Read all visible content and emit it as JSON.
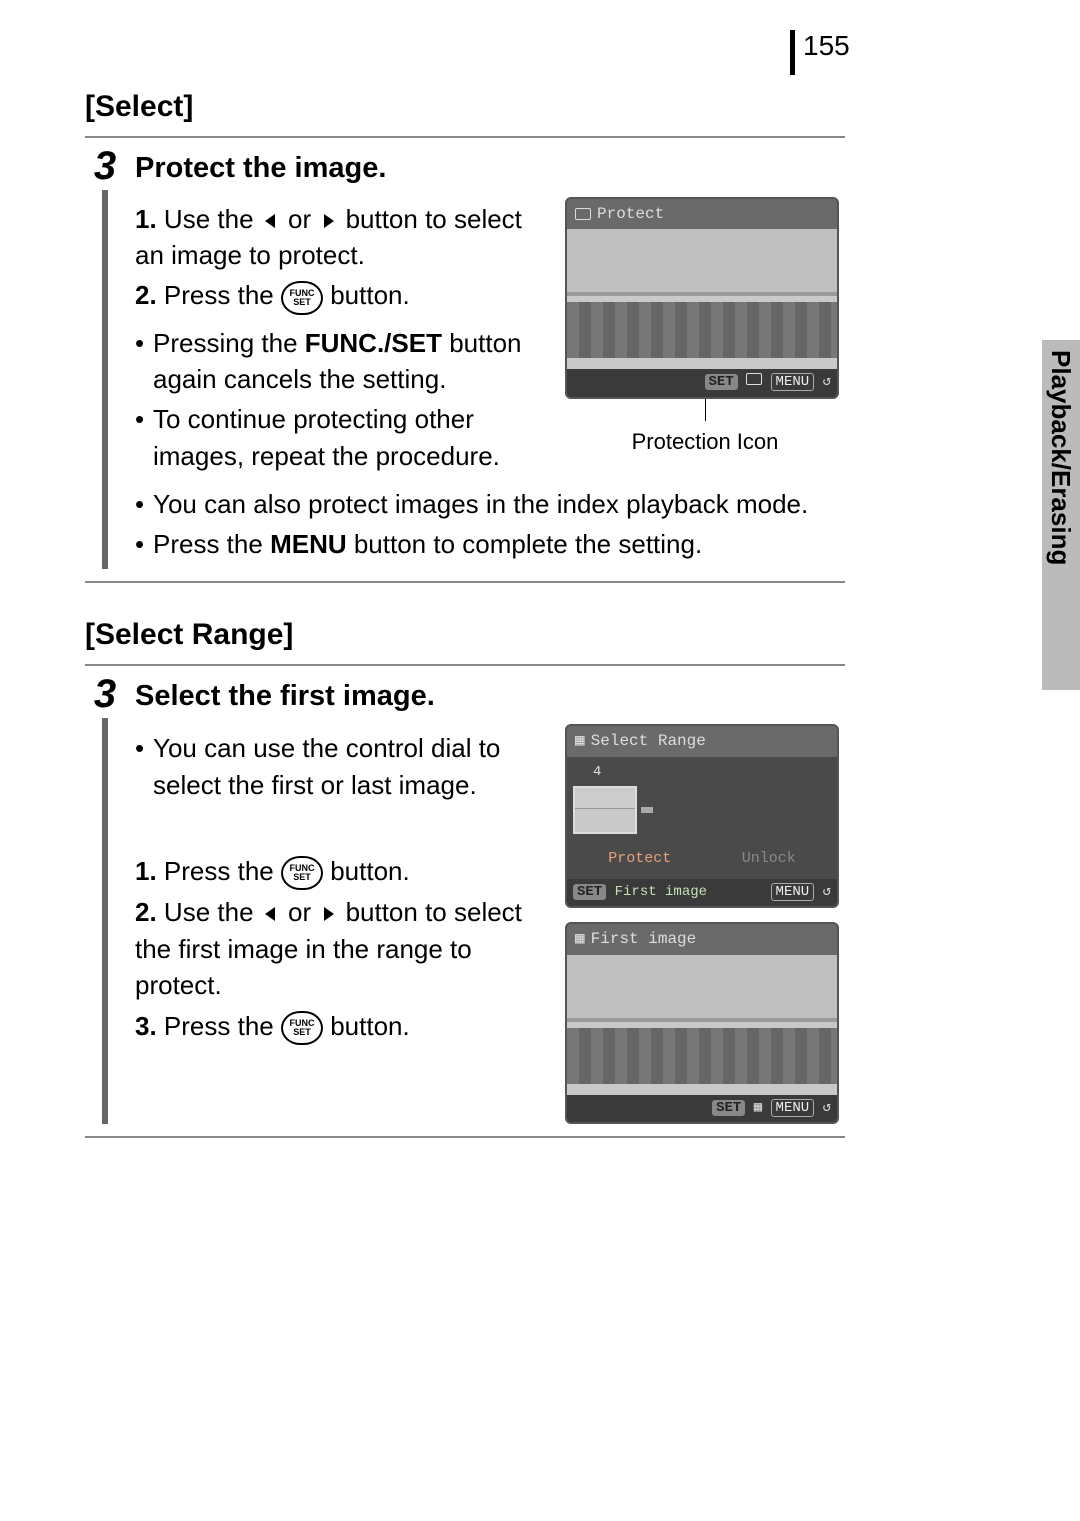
{
  "page_number": "155",
  "side_tab": "Playback/Erasing",
  "section1": {
    "heading": "[Select]",
    "step_number": "3",
    "title": "Protect the image.",
    "ol": [
      {
        "n": "1.",
        "before": "Use the ",
        "mid": " or ",
        "after": " button to select an image to protect."
      },
      {
        "n": "2.",
        "before": "Press the ",
        "after": " button."
      }
    ],
    "bullets_narrow": [
      {
        "a": "Pressing the ",
        "b": "FUNC./SET",
        "c": " button again cancels the setting."
      },
      {
        "a": "To continue protecting other images, repeat the procedure."
      }
    ],
    "bullets_full": [
      {
        "a": "You can also protect images in the index playback mode."
      },
      {
        "a": "Press the ",
        "b": "MENU",
        "c": " button to complete the setting."
      }
    ],
    "lcd": {
      "title": "Protect",
      "set": "SET",
      "menu": "MENU"
    },
    "caption": "Protection Icon"
  },
  "section2": {
    "heading": "[Select Range]",
    "step_number": "3",
    "title": "Select the first image.",
    "bullets": [
      "You can use the control dial to select the first or last image."
    ],
    "ol": [
      {
        "n": "1.",
        "before": "Press the ",
        "after": " button."
      },
      {
        "n": "2.",
        "before": "Use the ",
        "mid": " or ",
        "after": " button to select the first image in the range to protect."
      },
      {
        "n": "3.",
        "before": "Press the ",
        "after": " button."
      }
    ],
    "lcd1": {
      "title": "Select Range",
      "count": "4",
      "opt1": "Protect",
      "opt2": "Unlock",
      "set": "SET",
      "first": "First image",
      "menu": "MENU"
    },
    "lcd2": {
      "title": "First image",
      "set": "SET",
      "menu": "MENU"
    }
  },
  "icons": {
    "func_top": "FUNC",
    "func_bot": "SET"
  }
}
